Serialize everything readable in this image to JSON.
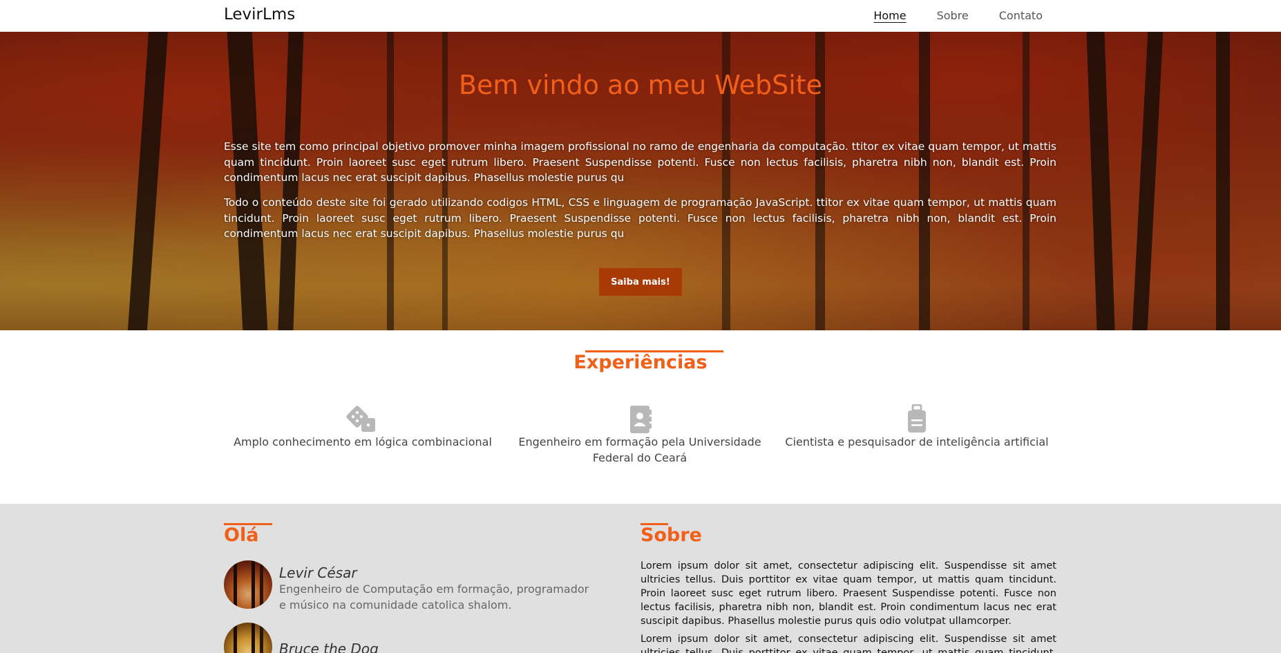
{
  "navbar": {
    "brand": "LevirLms",
    "links": [
      "Home",
      "Sobre",
      "Contato"
    ]
  },
  "hero": {
    "title": "Bem vindo ao meu WebSite",
    "paragraph1": "Esse site tem como principal objetivo promover minha imagem profissional no ramo de engenharia da computação. ttitor ex vitae quam tempor, ut mattis quam tincidunt. Proin laoreet susc eget rutrum libero. Praesent Suspendisse potenti. Fusce non lectus facilisis, pharetra nibh non, blandit est. Proin condimentum lacus nec erat suscipit dapibus. Phasellus molestie purus qu",
    "paragraph2": "Todo o conteúdo deste site foi gerado utilizando codigos HTML, CSS e linguagem de programação JavaScript. ttitor ex vitae quam tempor, ut mattis quam tincidunt. Proin laoreet susc eget rutrum libero. Praesent Suspendisse potenti. Fusce non lectus facilisis, pharetra nibh non, blandit est. Proin condimentum lacus nec erat suscipit dapibus. Phasellus molestie purus qu",
    "button": "Saiba mais!",
    "background": "autumn-forest-image"
  },
  "experiences": {
    "title": "Experiências",
    "items": [
      {
        "icon": "dice-icon",
        "label": "Amplo conhecimento em lógica combinacional"
      },
      {
        "icon": "address-book-icon",
        "label": "Engenheiro em formação pela Universidade Federal do Ceará"
      },
      {
        "icon": "suitcase-icon",
        "label": "Cientista e pesquisador de inteligência artificial"
      }
    ]
  },
  "hello": {
    "title": "Olá",
    "people": [
      {
        "name": "Levir César",
        "description": "Engenheiro de Computação em formação, programador e músico na comunidade catolica shalom."
      },
      {
        "name": "Bruce the Dog",
        "description": ""
      }
    ]
  },
  "about": {
    "title": "Sobre",
    "paragraph1": "Lorem ipsum dolor sit amet, consectetur adipiscing elit. Suspendisse sit amet ultricies tellus. Duis porttitor ex vitae quam tempor, ut mattis quam tincidunt. Proin laoreet susc eget rutrum libero. Praesent Suspendisse potenti. Fusce non lectus facilisis, pharetra nibh non, blandit est. Proin condimentum lacus nec erat suscipit dapibus. Phasellus molestie purus quis odio volutpat ullamcorper.",
    "paragraph2": "Lorem ipsum dolor sit amet, consectetur adipiscing elit. Suspendisse sit amet ultricies tellus. Duis porttitor ex vitae quam tempor, ut mattis quam tincidunt. Proin laoreet"
  },
  "colors": {
    "accent": "#f25f19",
    "button": "#a83a06",
    "lower_bg": "#e0e0e0",
    "icon_gray": "#b8b8b8"
  }
}
